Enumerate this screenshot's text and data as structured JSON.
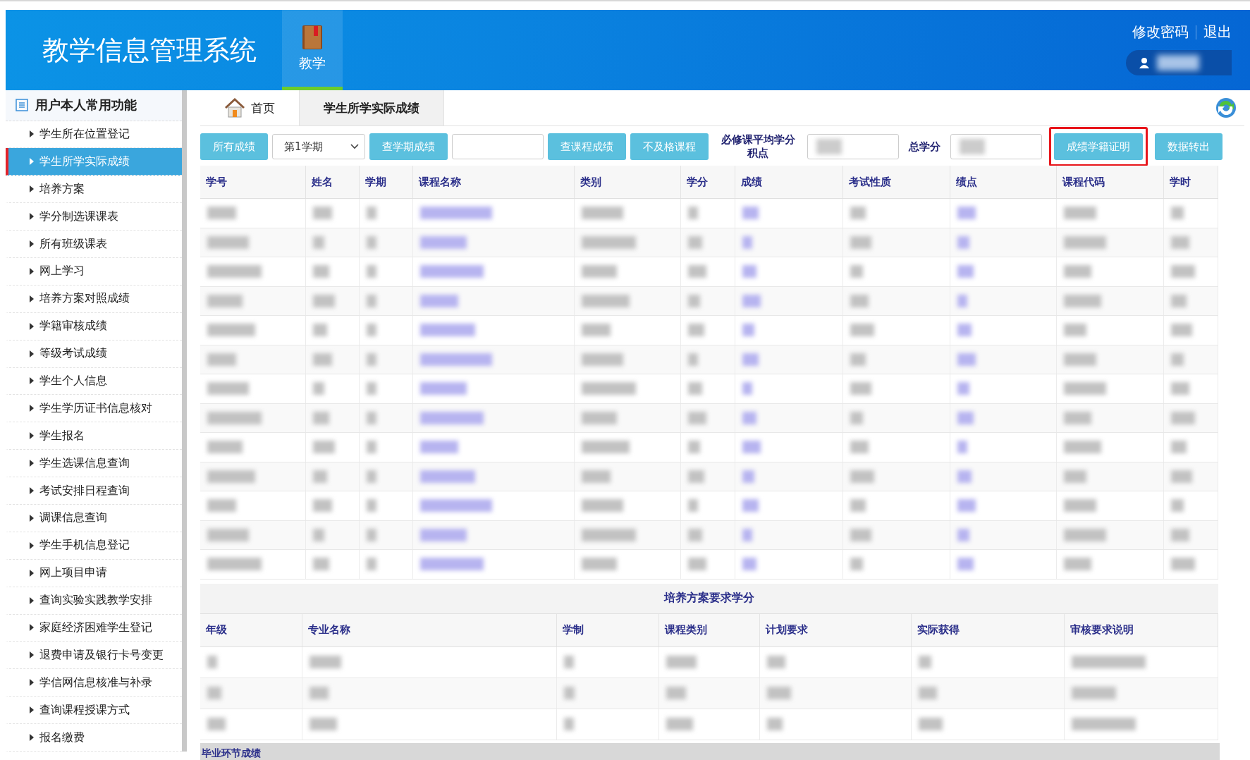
{
  "header": {
    "title": "教学信息管理系统",
    "nav": [
      {
        "label": "教学",
        "selected": true
      }
    ],
    "links": [
      "修改密码",
      "退出"
    ],
    "user": {
      "kind": "blurred"
    }
  },
  "sidebar": {
    "title": "用户本人常用功能",
    "items": [
      {
        "label": "学生所在位置登记",
        "selected": false
      },
      {
        "label": "学生所学实际成绩",
        "selected": true
      },
      {
        "label": "培养方案",
        "selected": false
      },
      {
        "label": "学分制选课课表",
        "selected": false
      },
      {
        "label": "所有班级课表",
        "selected": false
      },
      {
        "label": "网上学习",
        "selected": false
      },
      {
        "label": "培养方案对照成绩",
        "selected": false
      },
      {
        "label": "学籍审核成绩",
        "selected": false
      },
      {
        "label": "等级考试成绩",
        "selected": false
      },
      {
        "label": "学生个人信息",
        "selected": false
      },
      {
        "label": "学生学历证书信息核对",
        "selected": false
      },
      {
        "label": "学生报名",
        "selected": false
      },
      {
        "label": "学生选课信息查询",
        "selected": false
      },
      {
        "label": "考试安排日程查询",
        "selected": false
      },
      {
        "label": "调课信息查询",
        "selected": false
      },
      {
        "label": "学生手机信息登记",
        "selected": false
      },
      {
        "label": "网上项目申请",
        "selected": false
      },
      {
        "label": "查询实验实践教学安排",
        "selected": false
      },
      {
        "label": "家庭经济困难学生登记",
        "selected": false
      },
      {
        "label": "退费申请及银行卡号变更",
        "selected": false
      },
      {
        "label": "学信网信息核准与补录",
        "selected": false
      },
      {
        "label": "查询课程授课方式",
        "selected": false
      },
      {
        "label": "报名缴费",
        "selected": false
      }
    ]
  },
  "tabs": [
    {
      "label": "首页",
      "kind": "home",
      "selected": false
    },
    {
      "label": "学生所学实际成绩",
      "kind": "page",
      "selected": true
    }
  ],
  "toolbar": [
    {
      "kind": "button",
      "label": "所有成绩",
      "highlighted": false
    },
    {
      "kind": "select",
      "value": "第1学期"
    },
    {
      "kind": "button",
      "label": "查学期成绩",
      "highlighted": false
    },
    {
      "kind": "input"
    },
    {
      "kind": "button",
      "label": "查课程成绩",
      "highlighted": false
    },
    {
      "kind": "button",
      "label": "不及格课程",
      "highlighted": false
    },
    {
      "kind": "label",
      "label": "必修课平均学分积点"
    },
    {
      "kind": "input",
      "blurred": true
    },
    {
      "kind": "label",
      "label": "总学分"
    },
    {
      "kind": "input",
      "blurred": true
    },
    {
      "kind": "button",
      "label": "成绩学籍证明",
      "highlighted": true
    },
    {
      "kind": "button",
      "label": "数据转出",
      "highlighted": false
    }
  ],
  "grades_table": {
    "columns": [
      "学号",
      "姓名",
      "学期",
      "课程名称",
      "类别",
      "学分",
      "成绩",
      "考试性质",
      "绩点",
      "课程代码",
      "学时"
    ],
    "rows": [
      {
        "kind": "blurred"
      },
      {
        "kind": "blurred"
      },
      {
        "kind": "blurred"
      },
      {
        "kind": "blurred"
      },
      {
        "kind": "blurred"
      },
      {
        "kind": "blurred"
      },
      {
        "kind": "blurred"
      },
      {
        "kind": "blurred"
      },
      {
        "kind": "blurred"
      },
      {
        "kind": "blurred"
      },
      {
        "kind": "blurred"
      },
      {
        "kind": "blurred"
      },
      {
        "kind": "blurred"
      }
    ]
  },
  "plan_table": {
    "title": "培养方案要求学分",
    "columns": [
      "年级",
      "专业名称",
      "学制",
      "课程类别",
      "计划要求",
      "实际获得",
      "审核要求说明"
    ],
    "rows": [
      {
        "kind": "blurred"
      },
      {
        "kind": "blurred"
      },
      {
        "kind": "blurred"
      }
    ]
  },
  "next_section": {
    "title": "毕业环节成绩"
  }
}
